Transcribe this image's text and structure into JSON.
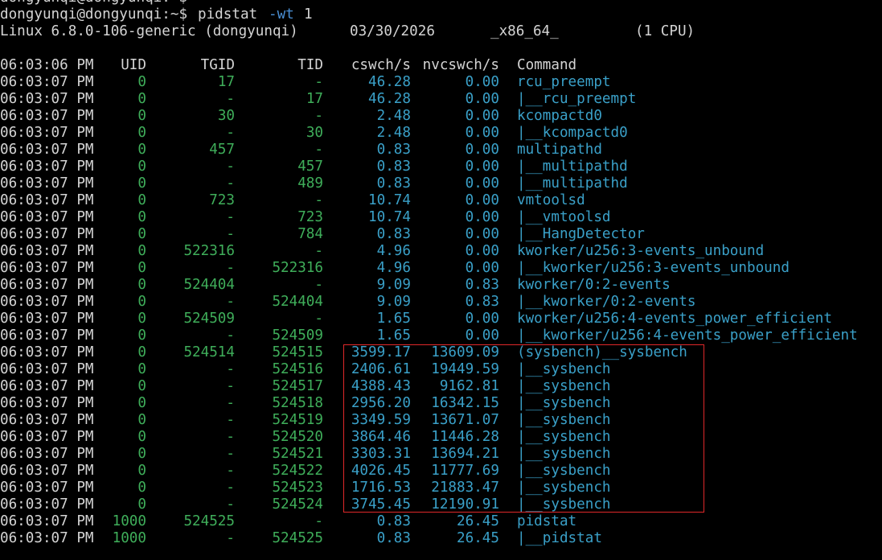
{
  "window": {
    "prev_prompt": "dongyunqi@dongyunqi:~$"
  },
  "command": {
    "prompt": "dongyunqi@dongyunqi:~$",
    "program": "pidstat",
    "argument": "-wt",
    "interval": "1"
  },
  "system_info": {
    "kernel": "Linux 6.8.0-106-generic (dongyunqi)",
    "date": "03/30/2026",
    "arch": "_x86_64_",
    "cpus": "(1 CPU)"
  },
  "table": {
    "header_time": "06:03:06 PM",
    "columns": [
      "UID",
      "TGID",
      "TID",
      "cswch/s",
      "nvcswch/s",
      "Command"
    ],
    "rows": [
      {
        "time": "06:03:07 PM",
        "uid": "0",
        "tgid": "17",
        "tid": "-",
        "cswch": "46.28",
        "nvcswch": "0.00",
        "command": "rcu_preempt"
      },
      {
        "time": "06:03:07 PM",
        "uid": "0",
        "tgid": "-",
        "tid": "17",
        "cswch": "46.28",
        "nvcswch": "0.00",
        "command": "|__rcu_preempt"
      },
      {
        "time": "06:03:07 PM",
        "uid": "0",
        "tgid": "30",
        "tid": "-",
        "cswch": "2.48",
        "nvcswch": "0.00",
        "command": "kcompactd0"
      },
      {
        "time": "06:03:07 PM",
        "uid": "0",
        "tgid": "-",
        "tid": "30",
        "cswch": "2.48",
        "nvcswch": "0.00",
        "command": "|__kcompactd0"
      },
      {
        "time": "06:03:07 PM",
        "uid": "0",
        "tgid": "457",
        "tid": "-",
        "cswch": "0.83",
        "nvcswch": "0.00",
        "command": "multipathd"
      },
      {
        "time": "06:03:07 PM",
        "uid": "0",
        "tgid": "-",
        "tid": "457",
        "cswch": "0.83",
        "nvcswch": "0.00",
        "command": "|__multipathd"
      },
      {
        "time": "06:03:07 PM",
        "uid": "0",
        "tgid": "-",
        "tid": "489",
        "cswch": "0.83",
        "nvcswch": "0.00",
        "command": "|__multipathd"
      },
      {
        "time": "06:03:07 PM",
        "uid": "0",
        "tgid": "723",
        "tid": "-",
        "cswch": "10.74",
        "nvcswch": "0.00",
        "command": "vmtoolsd"
      },
      {
        "time": "06:03:07 PM",
        "uid": "0",
        "tgid": "-",
        "tid": "723",
        "cswch": "10.74",
        "nvcswch": "0.00",
        "command": "|__vmtoolsd"
      },
      {
        "time": "06:03:07 PM",
        "uid": "0",
        "tgid": "-",
        "tid": "784",
        "cswch": "0.83",
        "nvcswch": "0.00",
        "command": "|__HangDetector"
      },
      {
        "time": "06:03:07 PM",
        "uid": "0",
        "tgid": "522316",
        "tid": "-",
        "cswch": "4.96",
        "nvcswch": "0.00",
        "command": "kworker/u256:3-events_unbound"
      },
      {
        "time": "06:03:07 PM",
        "uid": "0",
        "tgid": "-",
        "tid": "522316",
        "cswch": "4.96",
        "nvcswch": "0.00",
        "command": "|__kworker/u256:3-events_unbound"
      },
      {
        "time": "06:03:07 PM",
        "uid": "0",
        "tgid": "524404",
        "tid": "-",
        "cswch": "9.09",
        "nvcswch": "0.83",
        "command": "kworker/0:2-events"
      },
      {
        "time": "06:03:07 PM",
        "uid": "0",
        "tgid": "-",
        "tid": "524404",
        "cswch": "9.09",
        "nvcswch": "0.83",
        "command": "|__kworker/0:2-events"
      },
      {
        "time": "06:03:07 PM",
        "uid": "0",
        "tgid": "524509",
        "tid": "-",
        "cswch": "1.65",
        "nvcswch": "0.00",
        "command": "kworker/u256:4-events_power_efficient"
      },
      {
        "time": "06:03:07 PM",
        "uid": "0",
        "tgid": "-",
        "tid": "524509",
        "cswch": "1.65",
        "nvcswch": "0.00",
        "command": "|__kworker/u256:4-events_power_efficient"
      },
      {
        "time": "06:03:07 PM",
        "uid": "0",
        "tgid": "524514",
        "tid": "524515",
        "cswch": "3599.17",
        "nvcswch": "13609.09",
        "command": "(sysbench)__sysbench"
      },
      {
        "time": "06:03:07 PM",
        "uid": "0",
        "tgid": "-",
        "tid": "524516",
        "cswch": "2406.61",
        "nvcswch": "19449.59",
        "command": "|__sysbench"
      },
      {
        "time": "06:03:07 PM",
        "uid": "0",
        "tgid": "-",
        "tid": "524517",
        "cswch": "4388.43",
        "nvcswch": "9162.81",
        "command": "|__sysbench"
      },
      {
        "time": "06:03:07 PM",
        "uid": "0",
        "tgid": "-",
        "tid": "524518",
        "cswch": "2956.20",
        "nvcswch": "16342.15",
        "command": "|__sysbench"
      },
      {
        "time": "06:03:07 PM",
        "uid": "0",
        "tgid": "-",
        "tid": "524519",
        "cswch": "3349.59",
        "nvcswch": "13671.07",
        "command": "|__sysbench"
      },
      {
        "time": "06:03:07 PM",
        "uid": "0",
        "tgid": "-",
        "tid": "524520",
        "cswch": "3864.46",
        "nvcswch": "11446.28",
        "command": "|__sysbench"
      },
      {
        "time": "06:03:07 PM",
        "uid": "0",
        "tgid": "-",
        "tid": "524521",
        "cswch": "3303.31",
        "nvcswch": "13694.21",
        "command": "|__sysbench"
      },
      {
        "time": "06:03:07 PM",
        "uid": "0",
        "tgid": "-",
        "tid": "524522",
        "cswch": "4026.45",
        "nvcswch": "11777.69",
        "command": "|__sysbench"
      },
      {
        "time": "06:03:07 PM",
        "uid": "0",
        "tgid": "-",
        "tid": "524523",
        "cswch": "1716.53",
        "nvcswch": "21883.47",
        "command": "|__sysbench"
      },
      {
        "time": "06:03:07 PM",
        "uid": "0",
        "tgid": "-",
        "tid": "524524",
        "cswch": "3745.45",
        "nvcswch": "12190.91",
        "command": "|__sysbench"
      },
      {
        "time": "06:03:07 PM",
        "uid": "1000",
        "tgid": "524525",
        "tid": "-",
        "cswch": "0.83",
        "nvcswch": "26.45",
        "command": "pidstat"
      },
      {
        "time": "06:03:07 PM",
        "uid": "1000",
        "tgid": "-",
        "tid": "524525",
        "cswch": "0.83",
        "nvcswch": "26.45",
        "command": "|__pidstat"
      }
    ]
  },
  "colors": {
    "background": "#000000",
    "text": "#d4d4d4",
    "id_green": "#3fae5a",
    "command_blue": "#3aa0c8",
    "highlight_red": "#e0282a"
  }
}
